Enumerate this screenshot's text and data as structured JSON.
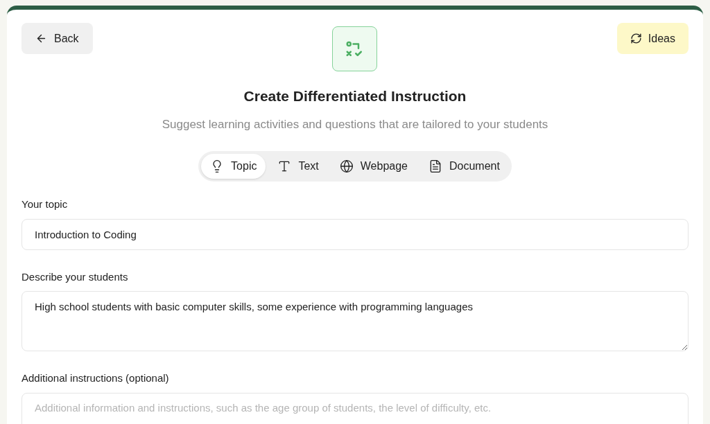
{
  "back_button": {
    "label": "Back"
  },
  "ideas_button": {
    "label": "Ideas"
  },
  "title": "Create Differentiated Instruction",
  "subtitle": "Suggest learning activities and questions that are tailored to your students",
  "tabs": [
    {
      "label": "Topic",
      "kind": "bulb",
      "selected": true
    },
    {
      "label": "Text",
      "kind": "type",
      "selected": false
    },
    {
      "label": "Webpage",
      "kind": "globe",
      "selected": false
    },
    {
      "label": "Document",
      "kind": "file",
      "selected": false
    }
  ],
  "fields": [
    {
      "label": "Your topic",
      "kind": "input",
      "value": "Introduction to Coding"
    },
    {
      "label": "Describe your students",
      "kind": "textarea",
      "value": "High school students with basic computer skills, some experience with programming languages"
    },
    {
      "label": "Additional instructions (optional)",
      "kind": "textarea_cut",
      "placeholder": "Additional information and instructions, such as the age group of students, the level of difficulty, etc."
    }
  ]
}
